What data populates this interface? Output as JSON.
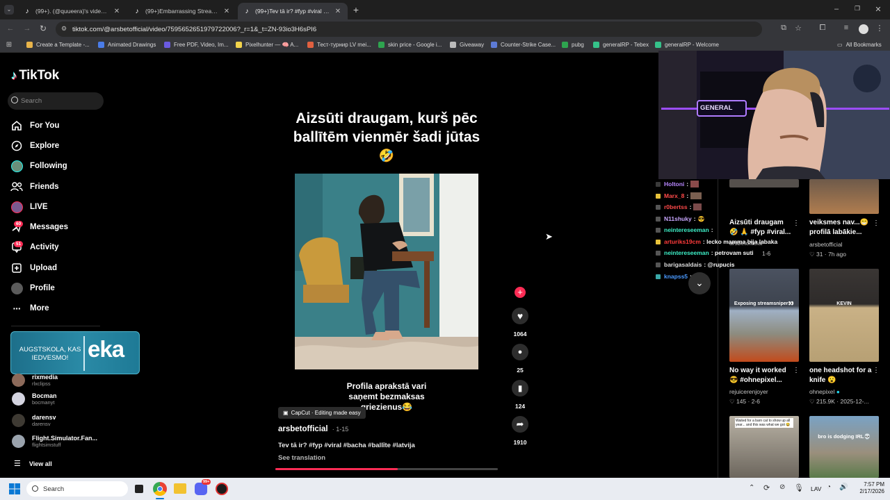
{
  "browser": {
    "tabs": [
      {
        "title": "(99+). (@quueera)'s videos with"
      },
      {
        "title": "(99+)Embarrassing Streaming M"
      },
      {
        "title": "(99+)Tev tā ir? #fyp #viral #bac"
      }
    ],
    "new_tab": "+",
    "url": "tiktok.com/@arsbetofficial/video/7595652651979722006?_r=1&_t=ZN-93io3H6sPI6",
    "bookmarks": [
      {
        "label": "Create a Template -...",
        "color": "#e8b44a"
      },
      {
        "label": "Animated Drawings",
        "color": "#4a7ce8"
      },
      {
        "label": "Free PDF, Video, Im...",
        "color": "#6a5ae0"
      },
      {
        "label": "Pixelhunter — 🧠 A...",
        "color": "#f2d34b"
      },
      {
        "label": "Тест-турнир LV mei...",
        "color": "#e06040"
      },
      {
        "label": "skin price - Google i...",
        "color": "#2ea44f"
      },
      {
        "label": "Giveaway",
        "color": "#bbbbbb"
      },
      {
        "label": "Counter-Strike Case...",
        "color": "#5d7bd6"
      },
      {
        "label": "pubg",
        "color": "#2ea44f"
      },
      {
        "label": "generalRP - Tebex",
        "color": "#35c28a"
      },
      {
        "label": "generalRP - Welcome",
        "color": "#35c28a"
      }
    ],
    "all_bookmarks": "All Bookmarks"
  },
  "tiktok": {
    "logo": "TikTok",
    "search_placeholder": "Search",
    "nav": [
      {
        "label": "For You",
        "icon": "home-icon"
      },
      {
        "label": "Explore",
        "icon": "compass-icon"
      },
      {
        "label": "Following",
        "icon": "following-avatar-icon"
      },
      {
        "label": "Friends",
        "icon": "friends-icon"
      },
      {
        "label": "LIVE",
        "icon": "live-icon"
      },
      {
        "label": "Messages",
        "icon": "messages-icon",
        "badge": "60"
      },
      {
        "label": "Activity",
        "icon": "activity-icon",
        "badge": "51"
      },
      {
        "label": "Upload",
        "icon": "upload-icon"
      },
      {
        "label": "Profile",
        "icon": "profile-avatar-icon"
      },
      {
        "label": "More",
        "icon": "more-icon"
      }
    ],
    "promo": {
      "left_text_1": "AUGSTSKOLA, KAS",
      "left_text_2": "IEDVESMO!",
      "brand": "eka"
    },
    "following_accounts": [
      {
        "name": "rixmedia",
        "handle": "rlxclipss"
      },
      {
        "name": "Bocman",
        "handle": "bocmanyt"
      },
      {
        "name": "darensv",
        "handle": "darensv"
      },
      {
        "name": "Flight.Simulator.Fan...",
        "handle": "flightsimstuff"
      }
    ],
    "view_all": "View all",
    "post": {
      "title_line_1": "Aizsūti draugam, kurš pēc",
      "title_line_2": "ballītēm vienmēr šadi jūtas",
      "title_emoji": "🤣",
      "caption_line_1": "Profila aprakstā vari",
      "caption_line_2": "saņemt bezmaksas",
      "caption_line_3": "griezienus😂",
      "capcut_label": "CapCut · Editing made easy",
      "author": "arsbetofficial",
      "date": "· 1-15",
      "description": "Tev tā ir? #fyp #viral #bacha #ballīte #latvija",
      "see_translation": "See translation",
      "progress": 0.55,
      "likes": "1064",
      "comments": "25",
      "saves": "124",
      "shares": "1910"
    },
    "related": [
      {
        "title_1": "Aizsūti draugam",
        "title_2": "🤣 🙏 #fyp #viral...",
        "author": "arsbetofficial",
        "stats": "1-6"
      },
      {
        "title_1": "veiksmes nav...😁",
        "title_2": "profilā labākie...",
        "author": "arsbetofficial",
        "stats": "♡ 31 · 7h ago"
      },
      {
        "title_1": "No way it worked",
        "title_2": "😎 #ohnepixel...",
        "author": "rejuicerenjoyer",
        "stats": "♡ 145 · 2-6",
        "overlay": "Exposing streamsniper👀"
      },
      {
        "title_1": "one headshot for a",
        "title_2": "knife 😮",
        "author": "ohnepixel",
        "stats": "♡ 215.9K · 2025-12-...",
        "overlay": "KEVIN"
      },
      {
        "overlay": "Waited for a barn cat to show up all year... and this was what we got 😂"
      },
      {
        "overlay": "bro is dodging IRL💀"
      }
    ]
  },
  "stream_chat": [
    {
      "user": "Holtoni",
      "msg": ":",
      "color": "#b887ff"
    },
    {
      "user": "Marx_8",
      "msg": ":",
      "color": "#ff4a4a"
    },
    {
      "user": "r0bertss",
      "msg": ":",
      "color": "#ff4a4a"
    },
    {
      "user": "N11shuky",
      "msg": ":",
      "color": "#c9a7ff"
    },
    {
      "user": "neintereseeman",
      "msg": ":",
      "color": "#3ef0c8"
    },
    {
      "user": "arturiks19cm",
      "msg": ": lecko mamma bija labaka",
      "color": "#ff3b3b"
    },
    {
      "user": "neintereseeman",
      "msg": ": petrovam suti",
      "color": "#3ef0c8"
    },
    {
      "user": "barigasaldais",
      "msg": ": @rupucis",
      "color": "#dddddd"
    },
    {
      "user": "knapss5",
      "msg": ":",
      "color": "#4a9aff"
    }
  ],
  "stream_overlay": {
    "sign": "GENERAL"
  },
  "taskbar": {
    "search_placeholder": "Search",
    "lang": "LAV",
    "time": "7:57 PM",
    "date": "2/17/2026",
    "discord_badge": "99+"
  }
}
